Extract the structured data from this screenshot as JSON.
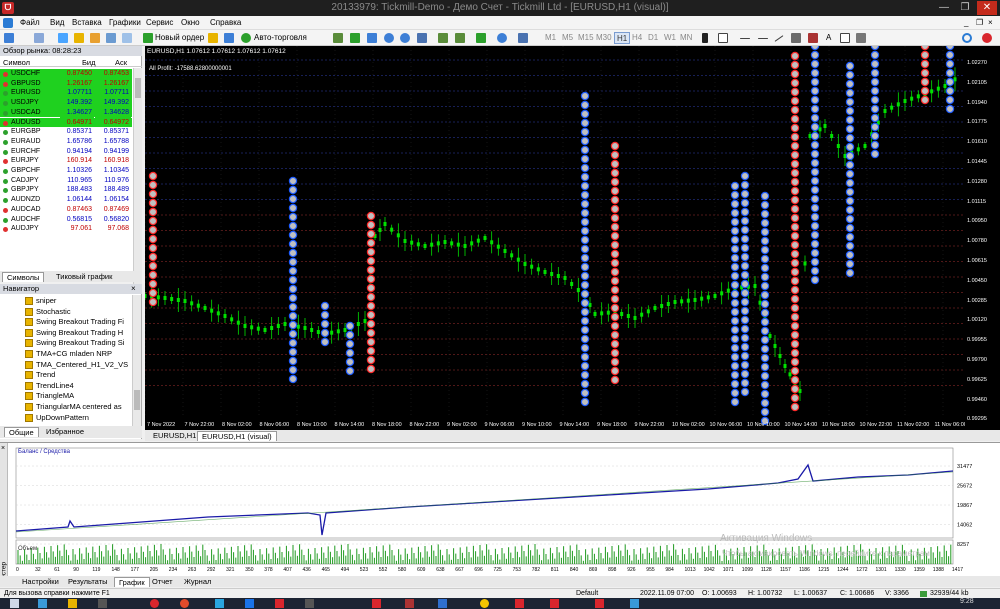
{
  "window": {
    "title": "20133979: Tickmill-Demo - Демо Счет - Tickmill Ltd - [EURUSD,H1 (visual)]",
    "logo": "ᗜ",
    "controls": [
      "—",
      "❐",
      "✕"
    ]
  },
  "menu": {
    "items": [
      "Файл",
      "Вид",
      "Вставка",
      "Графики",
      "Сервис",
      "Окно",
      "Справка"
    ],
    "right_controls": [
      "_",
      "❐",
      "×"
    ]
  },
  "toolbar": {
    "new_order": "Новый ордер",
    "autotrading": "Авто-торговля",
    "timeframes": [
      "M1",
      "M5",
      "M15",
      "M30",
      "H1",
      "H4",
      "D1",
      "W1",
      "MN"
    ],
    "active_timeframe": "H1"
  },
  "market_watch": {
    "title": "Обзор рынка: 08:28:23",
    "col_symbol": "Символ",
    "col_bid": "Бид",
    "col_ask": "Аск",
    "rows": [
      {
        "symbol": "USDCHF",
        "bid": "0.87450",
        "ask": "0.87453",
        "bg": "#1fd11f",
        "fg": "#c00000"
      },
      {
        "symbol": "GBPUSD",
        "bid": "1.26167",
        "ask": "1.26167",
        "bg": "#1fd11f",
        "fg": "#c00000"
      },
      {
        "symbol": "EURUSD",
        "bid": "1.07711",
        "ask": "1.07711",
        "bg": "#1fd11f",
        "fg": "#0000c0"
      },
      {
        "symbol": "USDJPY",
        "bid": "149.392",
        "ask": "149.392",
        "bg": "#1fd11f",
        "fg": "#0000c0"
      },
      {
        "symbol": "USDCAD",
        "bid": "1.34627",
        "ask": "1.34628",
        "bg": "#1fd11f",
        "fg": "#0000c0"
      },
      {
        "symbol": "AUDUSD",
        "bid": "0.64971",
        "ask": "0.64972",
        "bg": "#1fd11f",
        "fg": "#c00000"
      },
      {
        "symbol": "EURGBP",
        "bid": "0.85371",
        "ask": "0.85371",
        "bg": "#ffffff",
        "fg": "#0000c0"
      },
      {
        "symbol": "EURAUD",
        "bid": "1.65786",
        "ask": "1.65788",
        "bg": "#ffffff",
        "fg": "#0000c0"
      },
      {
        "symbol": "EURCHF",
        "bid": "0.94194",
        "ask": "0.94199",
        "bg": "#ffffff",
        "fg": "#0000c0"
      },
      {
        "symbol": "EURJPY",
        "bid": "160.914",
        "ask": "160.918",
        "bg": "#ffffff",
        "fg": "#c00000"
      },
      {
        "symbol": "GBPCHF",
        "bid": "1.10326",
        "ask": "1.10345",
        "bg": "#ffffff",
        "fg": "#0000c0"
      },
      {
        "symbol": "CADJPY",
        "bid": "110.965",
        "ask": "110.976",
        "bg": "#ffffff",
        "fg": "#0000c0"
      },
      {
        "symbol": "GBPJPY",
        "bid": "188.483",
        "ask": "188.489",
        "bg": "#ffffff",
        "fg": "#0000c0"
      },
      {
        "symbol": "AUDNZD",
        "bid": "1.06144",
        "ask": "1.06154",
        "bg": "#ffffff",
        "fg": "#0000c0"
      },
      {
        "symbol": "AUDCAD",
        "bid": "0.87463",
        "ask": "0.87469",
        "bg": "#ffffff",
        "fg": "#c00000"
      },
      {
        "symbol": "AUDCHF",
        "bid": "0.56815",
        "ask": "0.56820",
        "bg": "#ffffff",
        "fg": "#0000c0"
      },
      {
        "symbol": "AUDJPY",
        "bid": "97.061",
        "ask": "97.068",
        "bg": "#ffffff",
        "fg": "#c00000"
      }
    ],
    "tabs": [
      "Символы",
      "Тиковый график"
    ]
  },
  "navigator": {
    "title": "Навигатор",
    "items": [
      "sniper",
      "Stochastic",
      "Swing Breakout Trading Fi",
      "Swing Breakout Trading H",
      "Swing Breakout Trading Si",
      "TMA+CG mladen NRP",
      "TMA_Centered_H1_V2_VS",
      "Trend",
      "TrendLine4",
      "TriangleMA",
      "TriangularMA centered as",
      "UpDownPattern"
    ],
    "tabs": [
      "Общие",
      "Избранное"
    ]
  },
  "chart": {
    "header": "EURUSD,H1  1.07612 1.07612 1.07612 1.07612",
    "profit": "All Profit: -17588.62800000001",
    "price_ticks": [
      "1.02270",
      "1.02105",
      "1.01940",
      "1.01775",
      "1.01610",
      "1.01445",
      "1.01280",
      "1.01115",
      "1.00950",
      "1.00780",
      "1.00615",
      "1.00450",
      "1.00285",
      "1.00120",
      "0.99955",
      "0.99790",
      "0.99625",
      "0.99460",
      "0.99295"
    ],
    "time_ticks": [
      "7 Nov 2022",
      "7 Nov 22:00",
      "8 Nov 02:00",
      "8 Nov 06:00",
      "8 Nov 10:00",
      "8 Nov 14:00",
      "8 Nov 18:00",
      "8 Nov 22:00",
      "9 Nov 02:00",
      "9 Nov 06:00",
      "9 Nov 10:00",
      "9 Nov 14:00",
      "9 Nov 18:00",
      "9 Nov 22:00",
      "10 Nov 02:00",
      "10 Nov 06:00",
      "10 Nov 10:00",
      "10 Nov 14:00",
      "10 Nov 18:00",
      "10 Nov 22:00",
      "11 Nov 02:00",
      "11 Nov 06:00"
    ],
    "tabs": [
      "EURUSD,H1",
      "EURUSD,H1 (visual)"
    ],
    "active_tab": 1,
    "candle_color": "#00e000",
    "up_marker_color": "#1e5cff",
    "down_marker_color": "#ff2a2a"
  },
  "tester": {
    "side_label": "Тестер",
    "balance_label": "Баланс / Средства",
    "volume_label": "Объем",
    "y_ticks": [
      "31477",
      "25672",
      "19867",
      "14062",
      "8257"
    ],
    "x_ticks": [
      "0",
      "32",
      "61",
      "90",
      "119",
      "148",
      "177",
      "205",
      "234",
      "263",
      "292",
      "321",
      "350",
      "378",
      "407",
      "436",
      "465",
      "494",
      "523",
      "552",
      "580",
      "609",
      "638",
      "667",
      "696",
      "725",
      "753",
      "782",
      "811",
      "840",
      "869",
      "898",
      "926",
      "955",
      "984",
      "1013",
      "1042",
      "1071",
      "1099",
      "1128",
      "1157",
      "1186",
      "1215",
      "1244",
      "1272",
      "1301",
      "1330",
      "1359",
      "1388",
      "1417"
    ],
    "watermark_title": "Активация Windows",
    "watermark_sub": "Чтобы активировать Windows, перейдите к параметрам",
    "tabs": [
      "Настройки",
      "Результаты",
      "График",
      "Отчет",
      "Журнал"
    ],
    "active_tab": 2,
    "balance_color": "#1a1aa8",
    "equity_color": "#2e8b2e"
  },
  "status": {
    "help": "Для вызова справки нажмите F1",
    "profile": "Default",
    "datetime": "2022.11.09 07:00",
    "open": "O: 1.00693",
    "high": "H: 1.00732",
    "low": "L: 1.00637",
    "close": "C: 1.00686",
    "volume": "V: 3366",
    "traffic": "32939/44 kb"
  },
  "taskbar": {
    "clock": "9:28"
  }
}
